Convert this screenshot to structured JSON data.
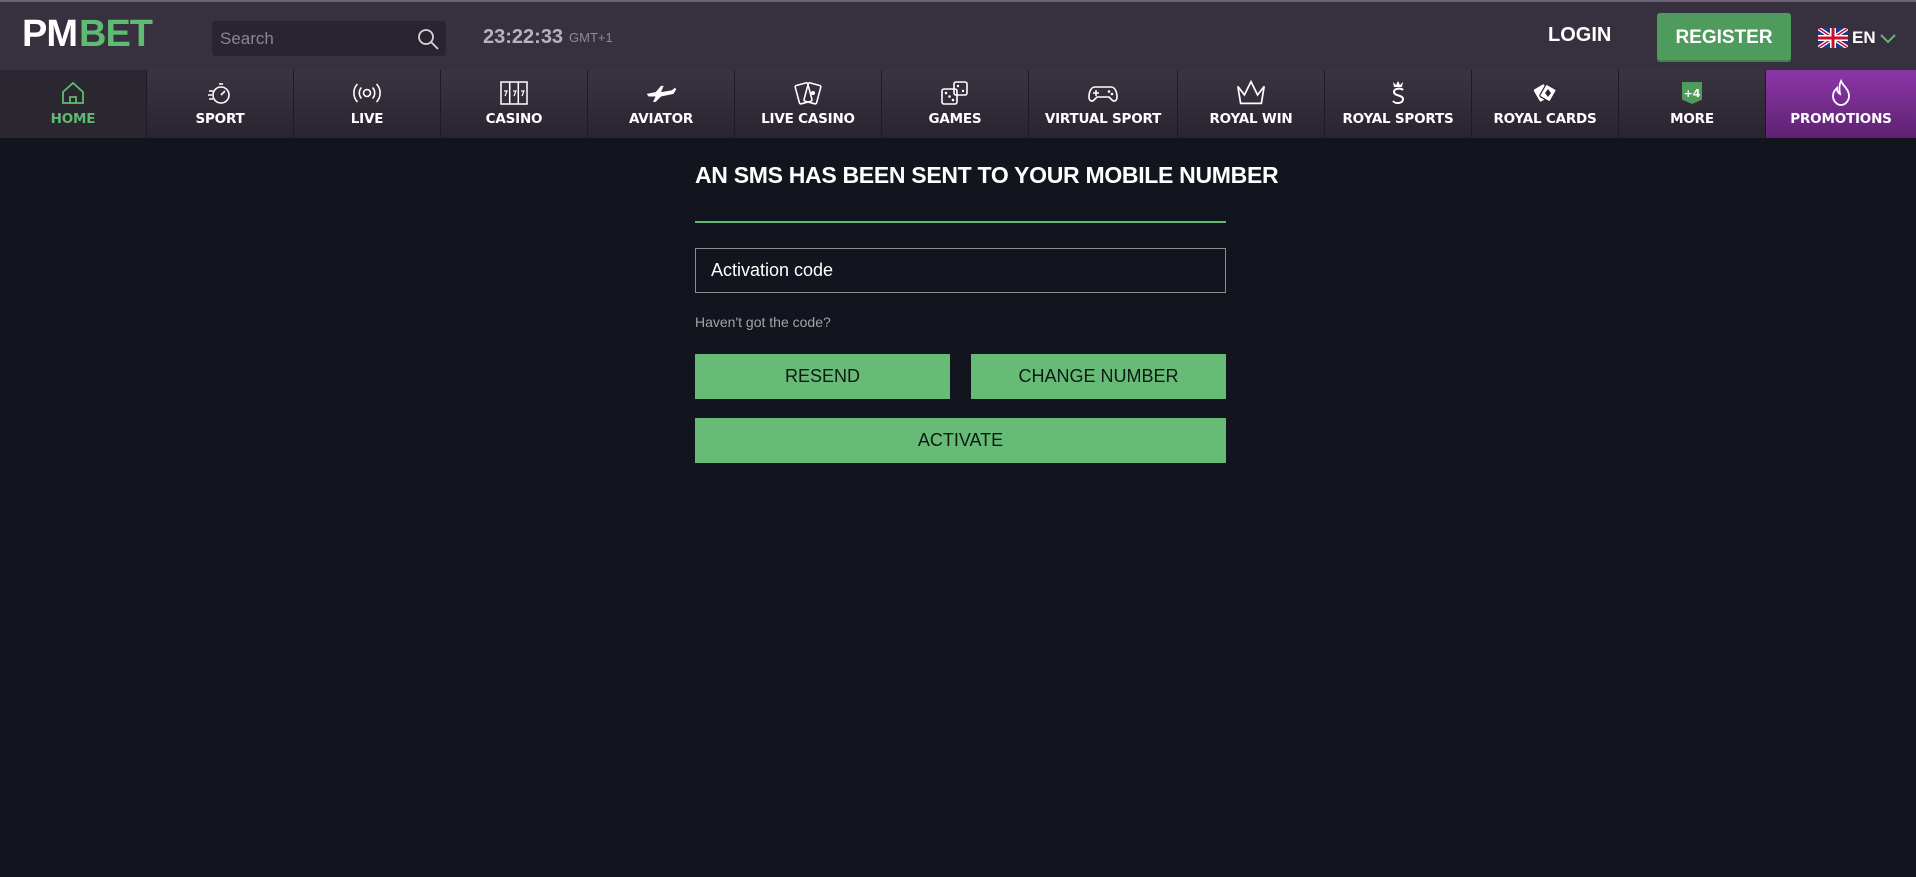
{
  "header": {
    "logo_pm": "PM",
    "logo_bet": "BET",
    "search_placeholder": "Search",
    "clock": "23:22:33",
    "timezone": "GMT+1",
    "login_label": "LOGIN",
    "register_label": "REGISTER",
    "language": "EN"
  },
  "nav": {
    "items": [
      {
        "label": "HOME",
        "icon": "home-icon",
        "active": true
      },
      {
        "label": "SPORT",
        "icon": "stopwatch-icon"
      },
      {
        "label": "LIVE",
        "icon": "broadcast-icon"
      },
      {
        "label": "CASINO",
        "icon": "slot-machine-icon"
      },
      {
        "label": "AVIATOR",
        "icon": "airplane-icon"
      },
      {
        "label": "LIVE CASINO",
        "icon": "playing-cards-icon"
      },
      {
        "label": "GAMES",
        "icon": "dice-icon"
      },
      {
        "label": "VIRTUAL SPORT",
        "icon": "gamepad-icon"
      },
      {
        "label": "ROYAL WIN",
        "icon": "crown-icon"
      },
      {
        "label": "ROYAL SPORTS",
        "icon": "royal-sports-icon"
      },
      {
        "label": "ROYAL CARDS",
        "icon": "cards-diamond-icon"
      },
      {
        "label": "MORE",
        "icon": "plus-badge-icon",
        "badge": "+4"
      },
      {
        "label": "PROMOTIONS",
        "icon": "flame-icon"
      }
    ]
  },
  "form": {
    "title": "AN SMS HAS BEEN SENT TO YOUR MOBILE NUMBER",
    "activation_placeholder": "Activation code",
    "hint": "Haven't got the code?",
    "resend_label": "RESEND",
    "change_number_label": "CHANGE NUMBER",
    "activate_label": "ACTIVATE"
  },
  "colors": {
    "accent_green": "#66bb77",
    "header_bg": "#36303f",
    "page_bg": "#12151d",
    "promo_purple": "#8c36a8"
  }
}
